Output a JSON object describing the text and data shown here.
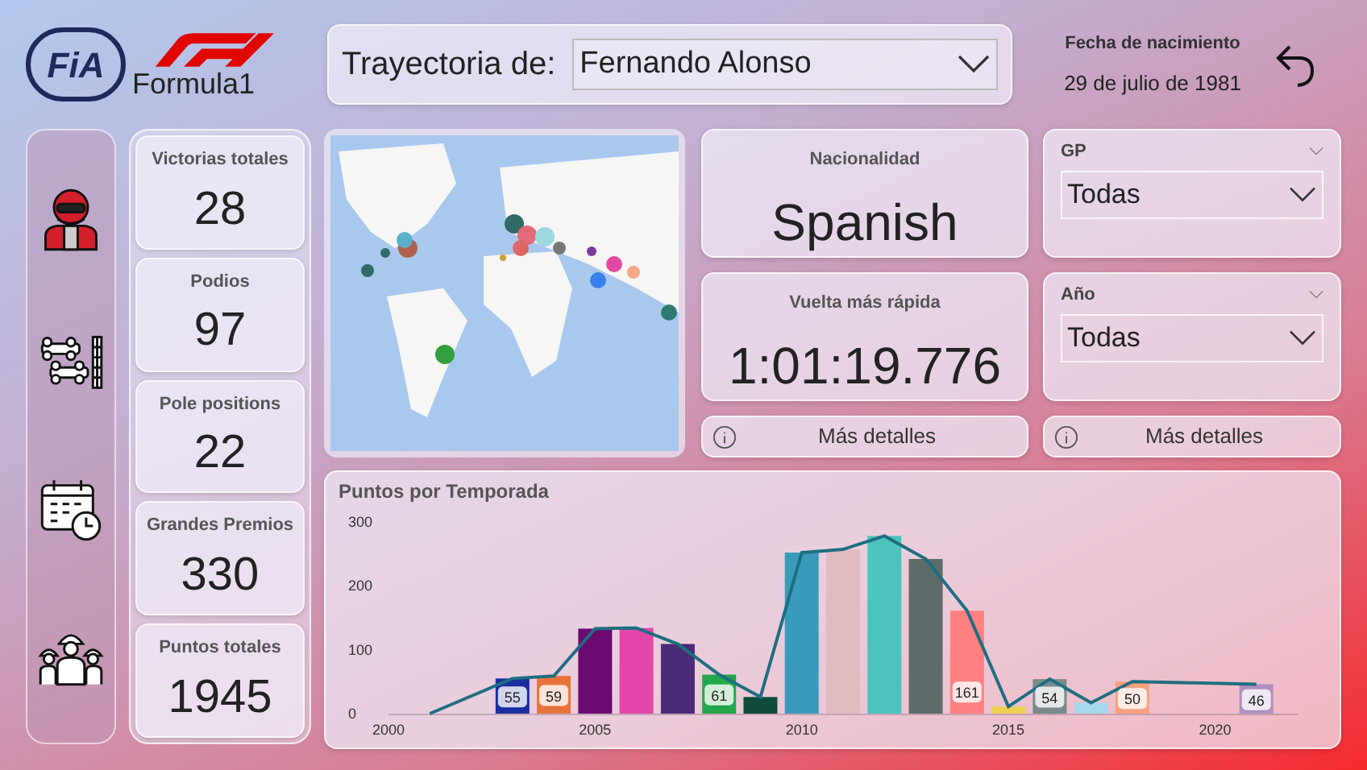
{
  "logos": {
    "fia": "FiA",
    "f1": "Formula1"
  },
  "header": {
    "selector_label": "Trayectoria de:",
    "selector_value": "Fernando Alonso",
    "birth_label": "Fecha de nacimiento",
    "birth_value": "29 de julio de 1981"
  },
  "nav": [
    {
      "kind": "driver",
      "selected": true
    },
    {
      "kind": "grid",
      "selected": false
    },
    {
      "kind": "calendar",
      "selected": false
    },
    {
      "kind": "team",
      "selected": false
    }
  ],
  "kpis": [
    {
      "label": "Victorias totales",
      "value": "28"
    },
    {
      "label": "Podios",
      "value": "97"
    },
    {
      "label": "Pole positions",
      "value": "22"
    },
    {
      "label": "Grandes Premios",
      "value": "330"
    },
    {
      "label": "Puntos totales",
      "value": "1945"
    }
  ],
  "info_cards": [
    {
      "label": "Nacionalidad",
      "value": "Spanish"
    },
    {
      "label": "Vuelta más rápida",
      "value": "1:01:19.776"
    }
  ],
  "slicers": [
    {
      "label": "GP",
      "value": "Todas"
    },
    {
      "label": "Año",
      "value": "Todas"
    }
  ],
  "detail_buttons": [
    "Más detalles",
    "Más detalles"
  ],
  "chart": {
    "chart_data": {
      "type": "bar",
      "title": "Puntos por Temporada",
      "x": [
        2001,
        2003,
        2004,
        2005,
        2006,
        2007,
        2008,
        2009,
        2010,
        2011,
        2012,
        2013,
        2014,
        2015,
        2016,
        2017,
        2018,
        2021
      ],
      "series": [
        {
          "type": "bar",
          "values": [
            null,
            55,
            59,
            133,
            134,
            109,
            61,
            26,
            252,
            257,
            278,
            242,
            161,
            11,
            54,
            17,
            50,
            46
          ],
          "colors": [
            null,
            "#1a2ea0",
            "#e8733a",
            "#6b0a70",
            "#e346a8",
            "#4b2a78",
            "#22a84a",
            "#0d4a3a",
            "#3a9aba",
            "#e0bcc0",
            "#4bc5bb",
            "#5e6b6b",
            "#ff8080",
            "#f0d050",
            "#7a8a8a",
            "#a8d8ec",
            "#f8a080",
            "#b090c0"
          ]
        },
        {
          "type": "line",
          "color": "#1f6e80",
          "values": [
            0,
            55,
            59,
            133,
            134,
            109,
            61,
            26,
            252,
            257,
            278,
            242,
            161,
            11,
            54,
            17,
            50,
            46
          ]
        }
      ],
      "value_labels": [
        null,
        "55",
        "59",
        null,
        null,
        null,
        "61",
        null,
        null,
        null,
        null,
        null,
        "161",
        null,
        "54",
        null,
        "50",
        "46"
      ],
      "xlim": [
        2000,
        2022
      ],
      "xticks": [
        2000,
        2005,
        2010,
        2015,
        2020
      ],
      "yticks": [
        0,
        100,
        200,
        300
      ],
      "ylim": [
        0,
        300
      ]
    }
  }
}
